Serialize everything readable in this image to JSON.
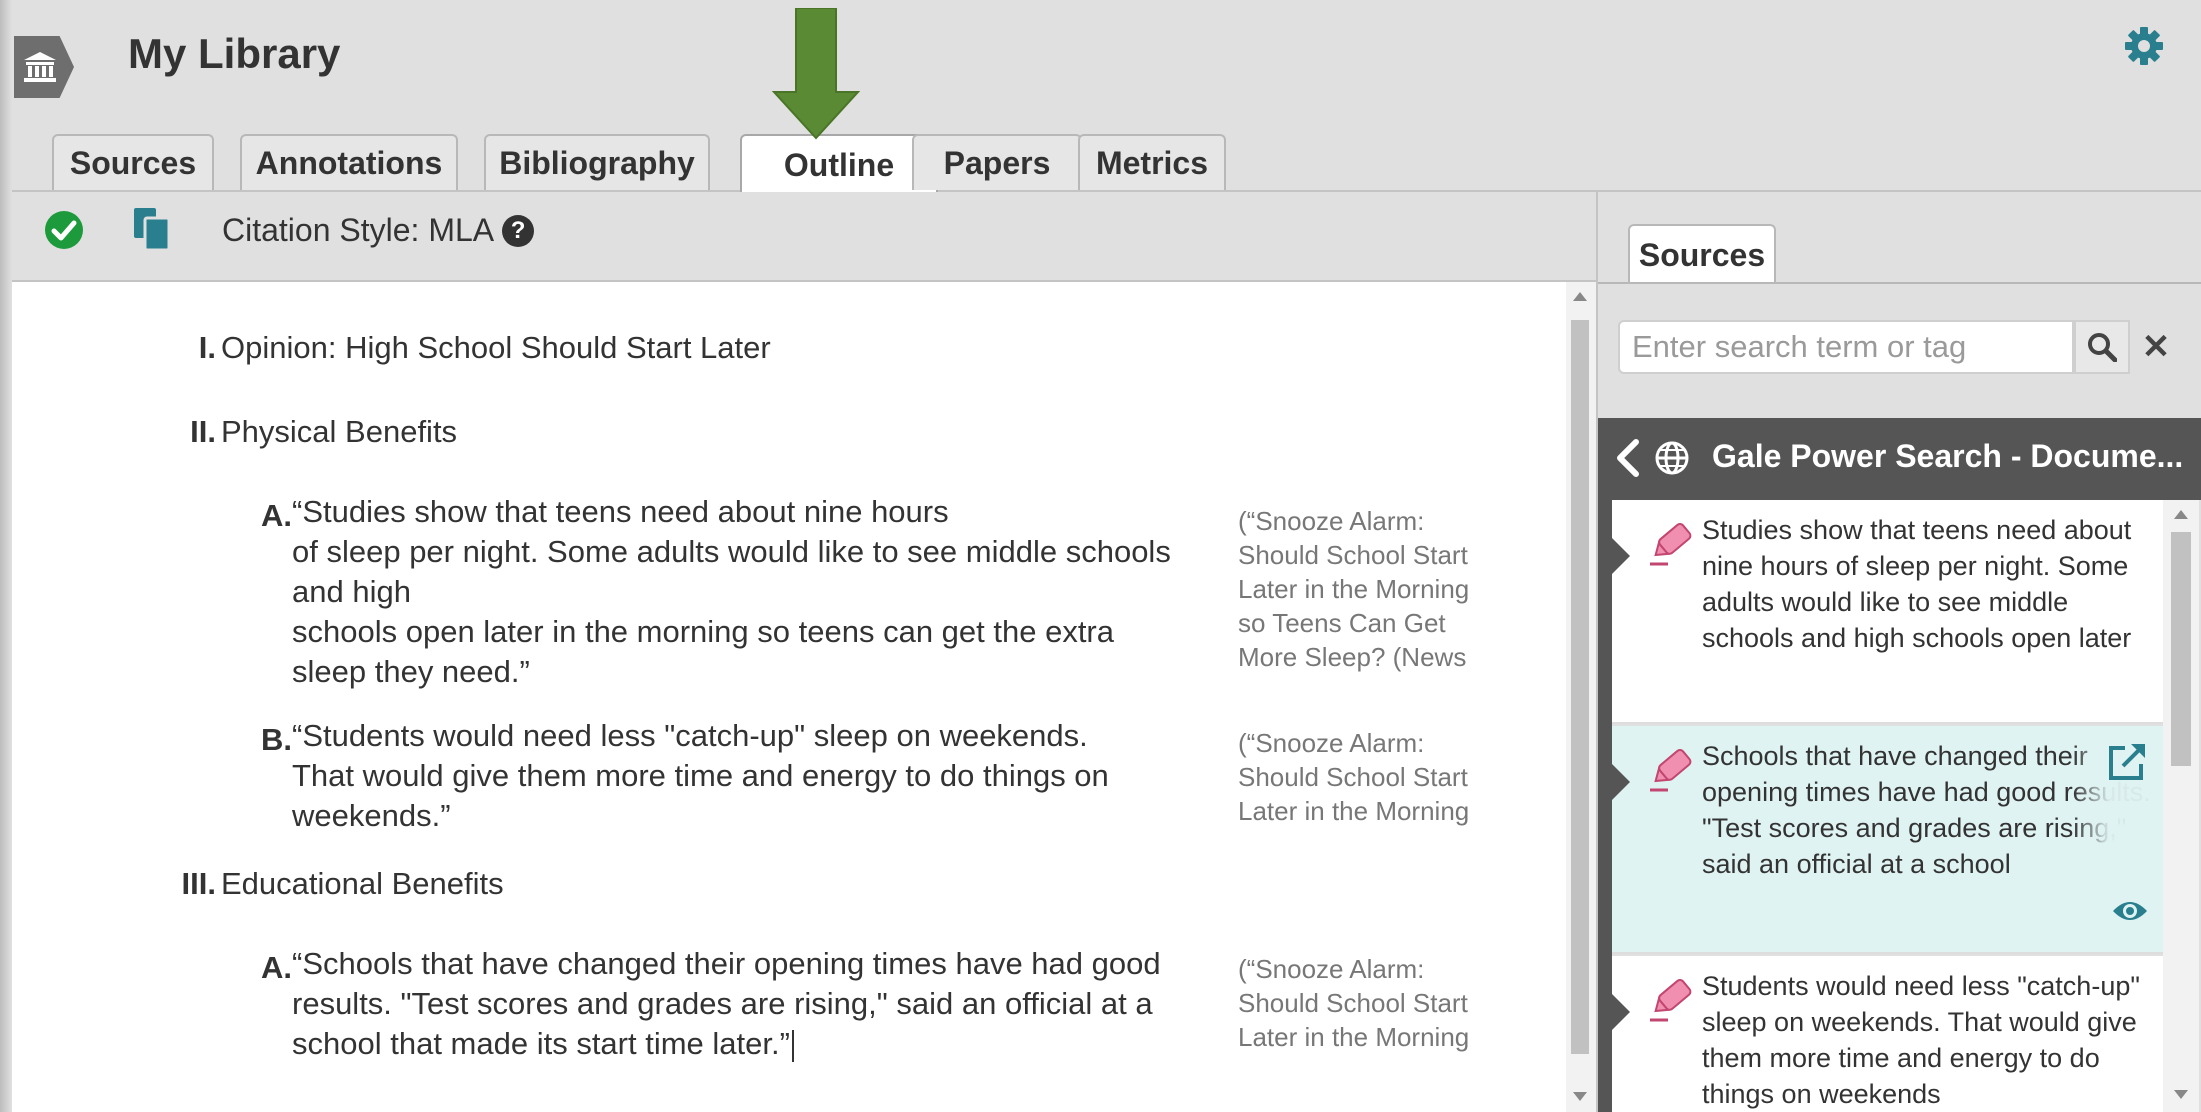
{
  "header": {
    "title": "My Library",
    "icons": {
      "library": "library-icon",
      "settings": "gear-icon",
      "pointer": "down-arrow-pointer"
    },
    "arrow_color": "#5a8a33",
    "accent_color": "#2a7f8f"
  },
  "tabs": [
    {
      "label": "Sources",
      "active": false
    },
    {
      "label": "Annotations",
      "active": false
    },
    {
      "label": "Bibliography",
      "active": false
    },
    {
      "label": "Outline",
      "active": true
    },
    {
      "label": "Papers",
      "active": false
    },
    {
      "label": "Metrics",
      "active": false
    }
  ],
  "toolbar": {
    "citation_style": "Citation Style: MLA",
    "icons": [
      "check-circle-icon",
      "copy-icon",
      "help-icon"
    ]
  },
  "outline": {
    "sections": [
      {
        "numeral": "I.",
        "heading": "Opinion: High School Should Start Later"
      },
      {
        "numeral": "II.",
        "heading": "Physical Benefits",
        "items": [
          {
            "letter": "A.",
            "lines": [
              "“Studies show that teens need about nine hours",
              "of sleep per night. Some adults would like to see middle schools",
              "and high",
              "schools open later in the morning so teens can get the extra",
              "sleep they need.”"
            ],
            "citation": [
              "(“Snooze Alarm:",
              "Should School Start",
              "Later in the Morning",
              "so Teens Can Get",
              "More Sleep? (News"
            ]
          },
          {
            "letter": "B.",
            "lines": [
              "“Students would need less \"catch-up\" sleep on weekends.",
              "That would give them more time and energy to do things on",
              "weekends.”"
            ],
            "citation": [
              "(“Snooze Alarm:",
              "Should School Start",
              "Later in the Morning"
            ]
          }
        ]
      },
      {
        "numeral": "III.",
        "heading": "Educational Benefits",
        "items": [
          {
            "letter": "A.",
            "lines": [
              "“Schools that have changed their opening times have had good",
              "results. \"Test scores and grades are rising,\" said an official at a",
              "school that made its start time later.”"
            ],
            "citation": [
              "(“Snooze Alarm:",
              "Should School Start",
              "Later in the Morning"
            ]
          }
        ]
      }
    ]
  },
  "right_panel": {
    "tab": "Sources",
    "search": {
      "placeholder": "Enter search term or tag",
      "value": ""
    },
    "clear_label": "✕",
    "document_title": "Gale Power Search - Docume...",
    "notes": [
      {
        "text": "Studies show that teens need about nine hours of sleep per night. Some adults would like to see middle schools and high schools open later",
        "selected": false
      },
      {
        "text": "Schools that have changed their opening times have had good results. \"Test scores and grades are rising,\" said an official at a school",
        "selected": true
      },
      {
        "text": "Students would need less \"catch-up\" sleep on weekends. That would give them more time and energy to do things on weekends",
        "selected": false
      }
    ],
    "highlight_color": "#f08fb0"
  }
}
